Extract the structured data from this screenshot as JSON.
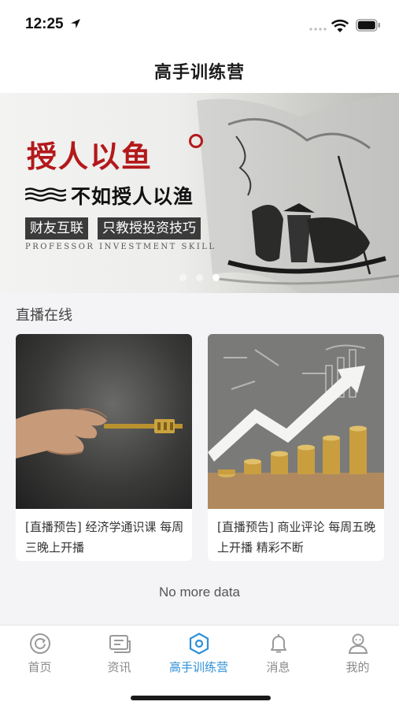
{
  "status_bar": {
    "time": "12:25"
  },
  "nav": {
    "title": "高手训练营"
  },
  "banner": {
    "title": "授人以鱼",
    "subtitle": "不如授人以渔",
    "tag_left": "财友互联",
    "tag_right": "只教授投资技巧",
    "english": "PROFESSOR INVESTMENT SKILL",
    "page_count": 3,
    "active_page": 3
  },
  "section": {
    "title": "直播在线"
  },
  "cards": [
    {
      "text": "[直播预告] 经济学通识课 每周三晚上开播"
    },
    {
      "text": "[直播预告] 商业评论 每周五晚上开播 精彩不断"
    }
  ],
  "list_footer": {
    "no_more": "No more data"
  },
  "tab_bar": {
    "active_color": "#2f8fd8",
    "items": [
      {
        "label": "首页",
        "icon": "home-refresh-icon"
      },
      {
        "label": "资讯",
        "icon": "news-icon"
      },
      {
        "label": "高手训练营",
        "icon": "hexagon-icon",
        "active": true
      },
      {
        "label": "消息",
        "icon": "bell-icon"
      },
      {
        "label": "我的",
        "icon": "user-icon"
      }
    ]
  }
}
